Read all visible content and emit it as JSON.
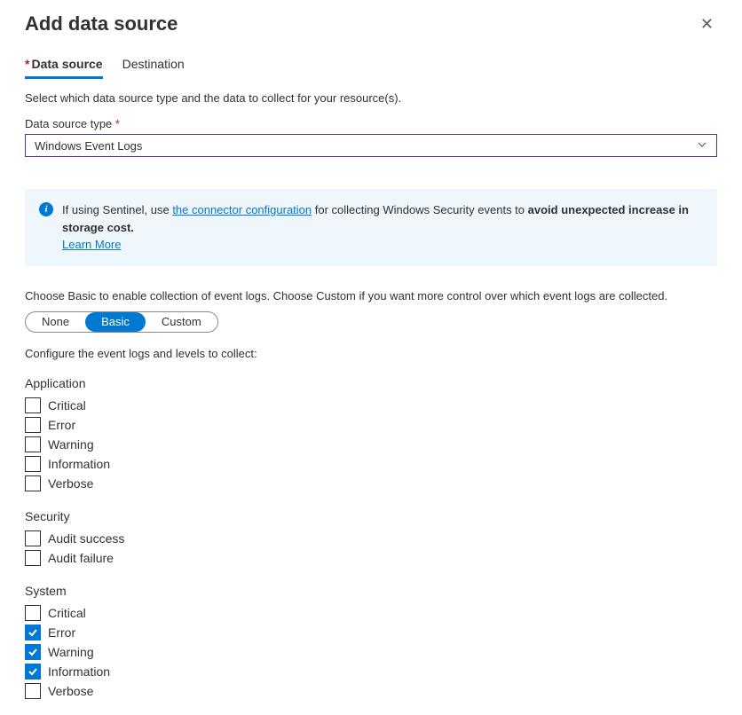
{
  "title": "Add data source",
  "tabs": [
    {
      "label": "Data source",
      "active": true,
      "required": true
    },
    {
      "label": "Destination",
      "active": false,
      "required": false
    }
  ],
  "description": "Select which data source type and the data to collect for your resource(s).",
  "field_label": "Data source type",
  "field_required_marker": "*",
  "dropdown_value": "Windows Event Logs",
  "info": {
    "prefix": "If using Sentinel, use ",
    "link1": "the connector configuration",
    "mid": " for collecting Windows Security events to ",
    "bold": "avoid unexpected increase in storage cost.",
    "learn_more": "Learn More"
  },
  "mode_description": "Choose Basic to enable collection of event logs. Choose Custom if you want more control over which event logs are collected.",
  "modes": [
    {
      "label": "None",
      "selected": false
    },
    {
      "label": "Basic",
      "selected": true
    },
    {
      "label": "Custom",
      "selected": false
    }
  ],
  "configure_text": "Configure the event logs and levels to collect:",
  "sections": [
    {
      "title": "Application",
      "items": [
        {
          "label": "Critical",
          "checked": false
        },
        {
          "label": "Error",
          "checked": false
        },
        {
          "label": "Warning",
          "checked": false
        },
        {
          "label": "Information",
          "checked": false
        },
        {
          "label": "Verbose",
          "checked": false
        }
      ]
    },
    {
      "title": "Security",
      "items": [
        {
          "label": "Audit success",
          "checked": false
        },
        {
          "label": "Audit failure",
          "checked": false
        }
      ]
    },
    {
      "title": "System",
      "items": [
        {
          "label": "Critical",
          "checked": false
        },
        {
          "label": "Error",
          "checked": true
        },
        {
          "label": "Warning",
          "checked": true
        },
        {
          "label": "Information",
          "checked": true
        },
        {
          "label": "Verbose",
          "checked": false
        }
      ]
    }
  ]
}
